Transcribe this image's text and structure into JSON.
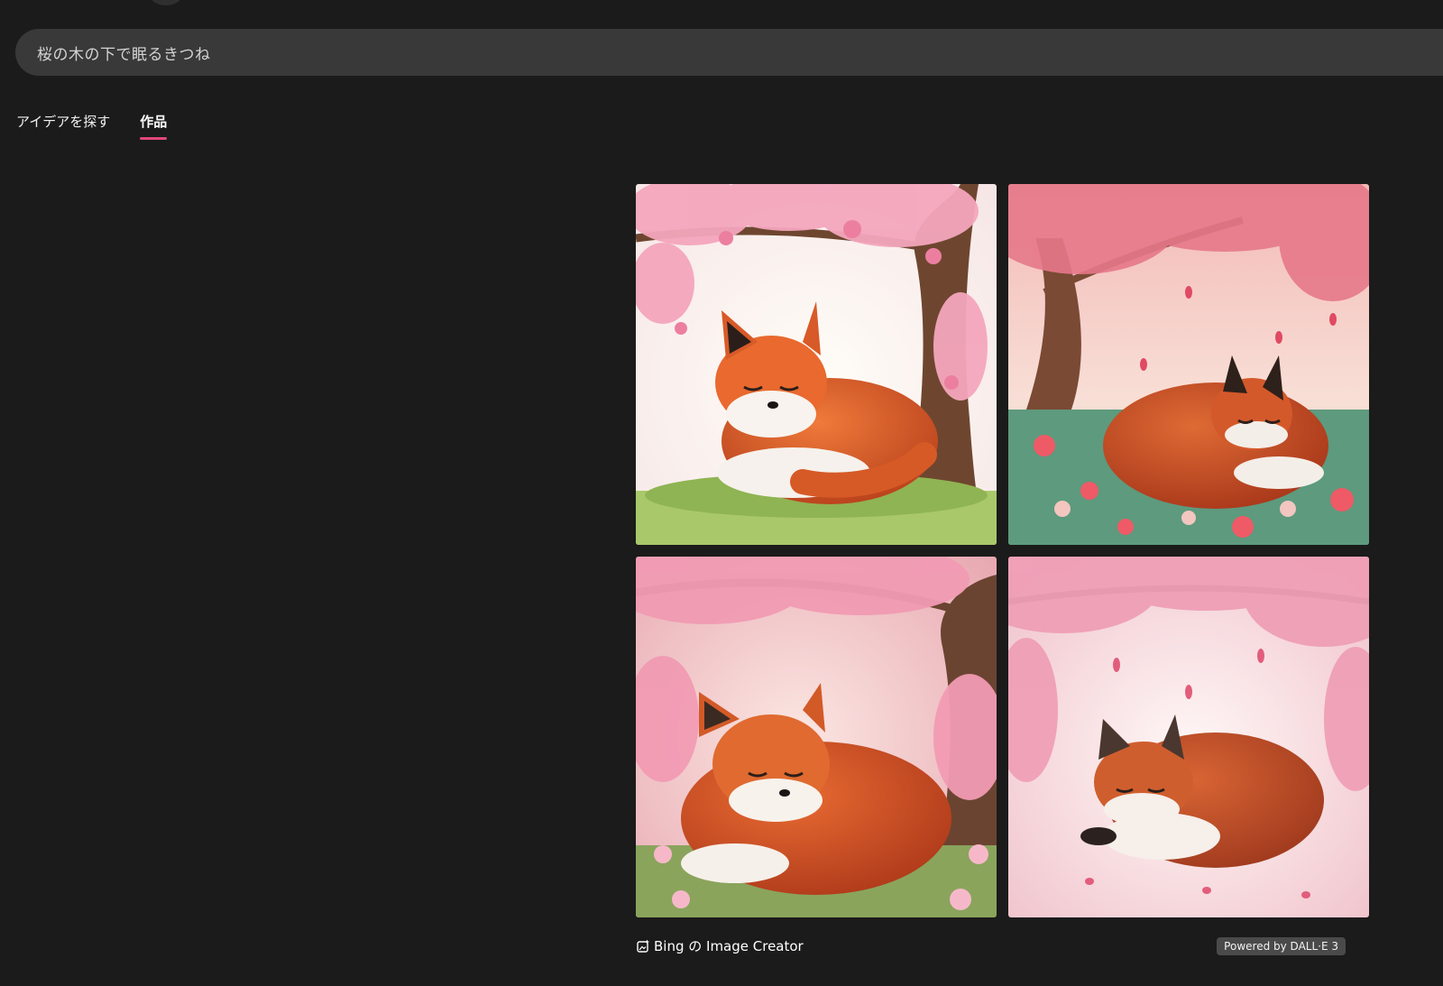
{
  "search": {
    "prompt": "桜の木の下で眠るきつね"
  },
  "tabs": [
    {
      "label": "アイデアを探す",
      "active": false
    },
    {
      "label": "作品",
      "active": true
    }
  ],
  "accent_color": "#e0487a",
  "gallery": {
    "images": [
      {
        "subject": "sleeping fox under cherry tree, white background"
      },
      {
        "subject": "sleeping fox on flower meadow, pink background"
      },
      {
        "subject": "sleeping fox in pink blossom field"
      },
      {
        "subject": "sleeping fox with falling petals"
      }
    ]
  },
  "footer": {
    "brand_icon": "image-sparkle-icon",
    "brand_label": "Bing の Image Creator",
    "powered_label": "Powered by DALL·E 3"
  }
}
